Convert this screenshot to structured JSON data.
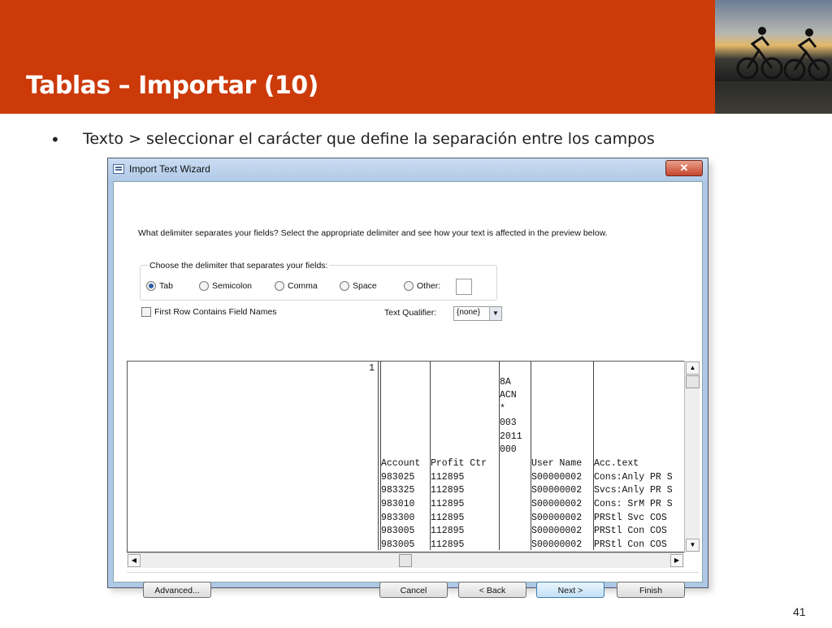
{
  "slide": {
    "title": "Tablas – Importar (10)",
    "bullet_symbol": "•",
    "bullet_text": "Texto > seleccionar el carácter que define la separación entre los campos",
    "page_number": "41"
  },
  "dialog": {
    "title": "Import Text Wizard",
    "close_glyph": "✕",
    "prompt": "What delimiter separates your fields? Select the appropriate delimiter and see how your text is affected in the preview below.",
    "delimiter_group_label": "Choose the delimiter that separates your fields:",
    "delimiters": [
      {
        "label": "Tab",
        "selected": true
      },
      {
        "label": "Semicolon",
        "selected": false
      },
      {
        "label": "Comma",
        "selected": false
      },
      {
        "label": "Space",
        "selected": false
      },
      {
        "label": "Other:",
        "selected": false
      }
    ],
    "other_value": "",
    "first_row_label": "First Row Contains Field Names",
    "first_row_checked": false,
    "text_qualifier_label": "Text Qualifier:",
    "text_qualifier_value": "{none}",
    "preview": {
      "col1": "1",
      "col2": "\n\n\n\n\n\n\nAccount\n983025\n983325\n983010\n983300\n983005\n983005",
      "col3": "\n\n\n\n\n\n\nProfit Ctr\n112895\n112895\n112895\n112895\n112895\n112895",
      "col4": "\n8A\nACN\n*\n003\n2011\n000",
      "col5": "\n\n\n\n\n\n\nUser Name\nS00000002\nS00000002\nS00000002\nS00000002\nS00000002\nS00000002",
      "col6": "\n\n\n\n\n\n\nAcc.text\nCons:Anly PR S\nSvcs:Anly PR S\nCons: SrM PR S\nPRStl Svc COS\nPRStl Con COS\nPRStl Con COS"
    },
    "buttons": {
      "advanced": "Advanced...",
      "cancel": "Cancel",
      "back": "< Back",
      "next": "Next >",
      "finish": "Finish"
    }
  }
}
